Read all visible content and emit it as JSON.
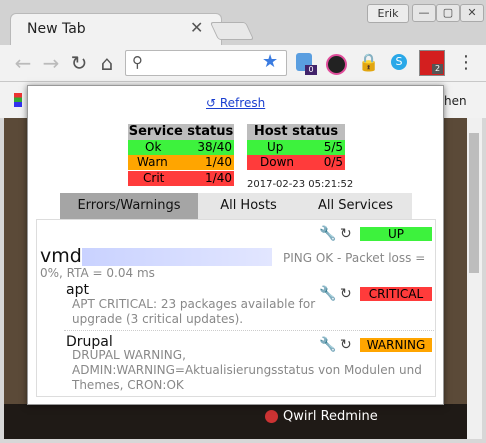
{
  "browser": {
    "tab_title": "New Tab",
    "tab_close": "✕",
    "profile": "Erik",
    "win_min": "—",
    "win_max": "▢",
    "win_close": "✕",
    "badges": {
      "ext1": "0",
      "ext2": "2"
    }
  },
  "popup": {
    "refresh": "↺ Refresh",
    "service_status": {
      "title": "Service status",
      "rows": [
        {
          "label": "Ok",
          "value": "38/40",
          "color": "#3df23d"
        },
        {
          "label": "Warn",
          "value": "1/40",
          "color": "#ffa500"
        },
        {
          "label": "Crit",
          "value": "1/40",
          "color": "#ff3b3b"
        }
      ]
    },
    "host_status": {
      "title": "Host status",
      "rows": [
        {
          "label": "Up",
          "value": "5/5",
          "color": "#3df23d"
        },
        {
          "label": "Down",
          "value": "0/5",
          "color": "#ff3b3b"
        }
      ]
    },
    "timestamp": "2017-02-23 05:21:52",
    "tabs": [
      "Errors/Warnings",
      "All Hosts",
      "All Services"
    ],
    "host": {
      "name": "vmd1",
      "status": "UP",
      "status_color": "#3df23d",
      "info": "PING OK - Packet loss = 0%, RTA = 0.04 ms"
    },
    "services": [
      {
        "name": "apt",
        "status": "CRITICAL",
        "status_color": "#ff3b3b",
        "text": "APT CRITICAL: 23 packages available for upgrade (3 critical updates)."
      },
      {
        "name": "Drupal",
        "status": "WARNING",
        "status_color": "#ffa500",
        "text": "DRUPAL WARNING, ADMIN:WARNING=Aktualisierungsstatus von Modulen und Themes, CRON:OK"
      }
    ]
  },
  "background": {
    "bookmark_text": "hen",
    "bottom_link": "Qwirl Redmine"
  }
}
